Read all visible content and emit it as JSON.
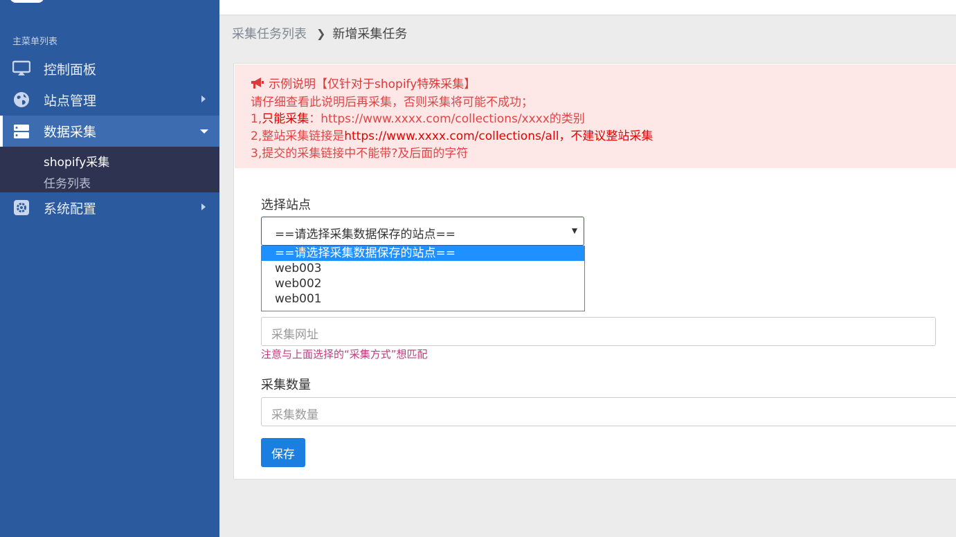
{
  "sidebar": {
    "menu_header": "主菜单列表",
    "items": [
      {
        "label": "控制面板",
        "icon": "monitor-icon"
      },
      {
        "label": "站点管理",
        "icon": "globe-icon"
      },
      {
        "label": "数据采集",
        "icon": "server-icon"
      },
      {
        "label": "系统配置",
        "icon": "gear-icon"
      }
    ],
    "submenu": [
      {
        "label": "shopify采集"
      },
      {
        "label": "任务列表"
      }
    ]
  },
  "breadcrumb": {
    "parent": "采集任务列表",
    "current": "新增采集任务"
  },
  "alert": {
    "title": "示例说明【仅针对于shopify特殊采集】",
    "line2": "请仔细查看此说明后再采集，否则采集将可能不成功；",
    "line3_prefix": "1,",
    "line3_red": "只能采集",
    "line3_rest": "：https://www.xxxx.com/collections/xxxx的类别",
    "line4_prefix": "2,整站采集链接是",
    "line4_red": "https://www.xxxx.com/collections/all，不建议整站采集",
    "line5": "3,提交的采集链接中不能带?及后面的字符"
  },
  "form": {
    "site_label": "选择站点",
    "site_selected": "==请选择采集数据保存的站点==",
    "site_options": [
      "==请选择采集数据保存的站点==",
      "web003",
      "web002",
      "web001"
    ],
    "url_placeholder": "采集网址",
    "url_hint": "注意与上面选择的“采集方式”想匹配",
    "count_label": "采集数量",
    "count_placeholder": "采集数量",
    "save_label": "保存"
  },
  "colors": {
    "sidebar_bg": "#2c5a9f",
    "submenu_bg": "#2d3350",
    "alert_bg": "#fde7e7",
    "primary": "#1a7fe0"
  }
}
